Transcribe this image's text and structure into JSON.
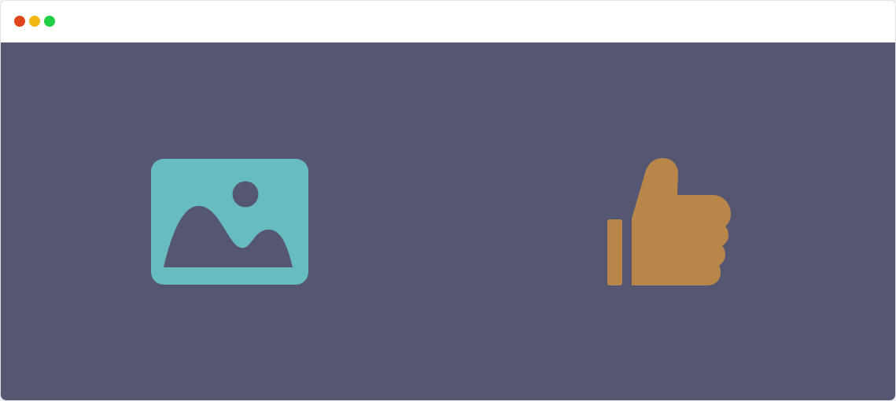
{
  "window": {
    "background": "#ffffff",
    "content_background": "#555772",
    "traffic_lights": [
      {
        "name": "close",
        "color": "#e0461c"
      },
      {
        "name": "minimize",
        "color": "#f2b613"
      },
      {
        "name": "maximize",
        "color": "#1fcf45"
      }
    ]
  },
  "icons": [
    {
      "name": "image-icon",
      "color": "#67bcc0"
    },
    {
      "name": "thumbs-up-icon",
      "color": "#b9864a"
    }
  ]
}
